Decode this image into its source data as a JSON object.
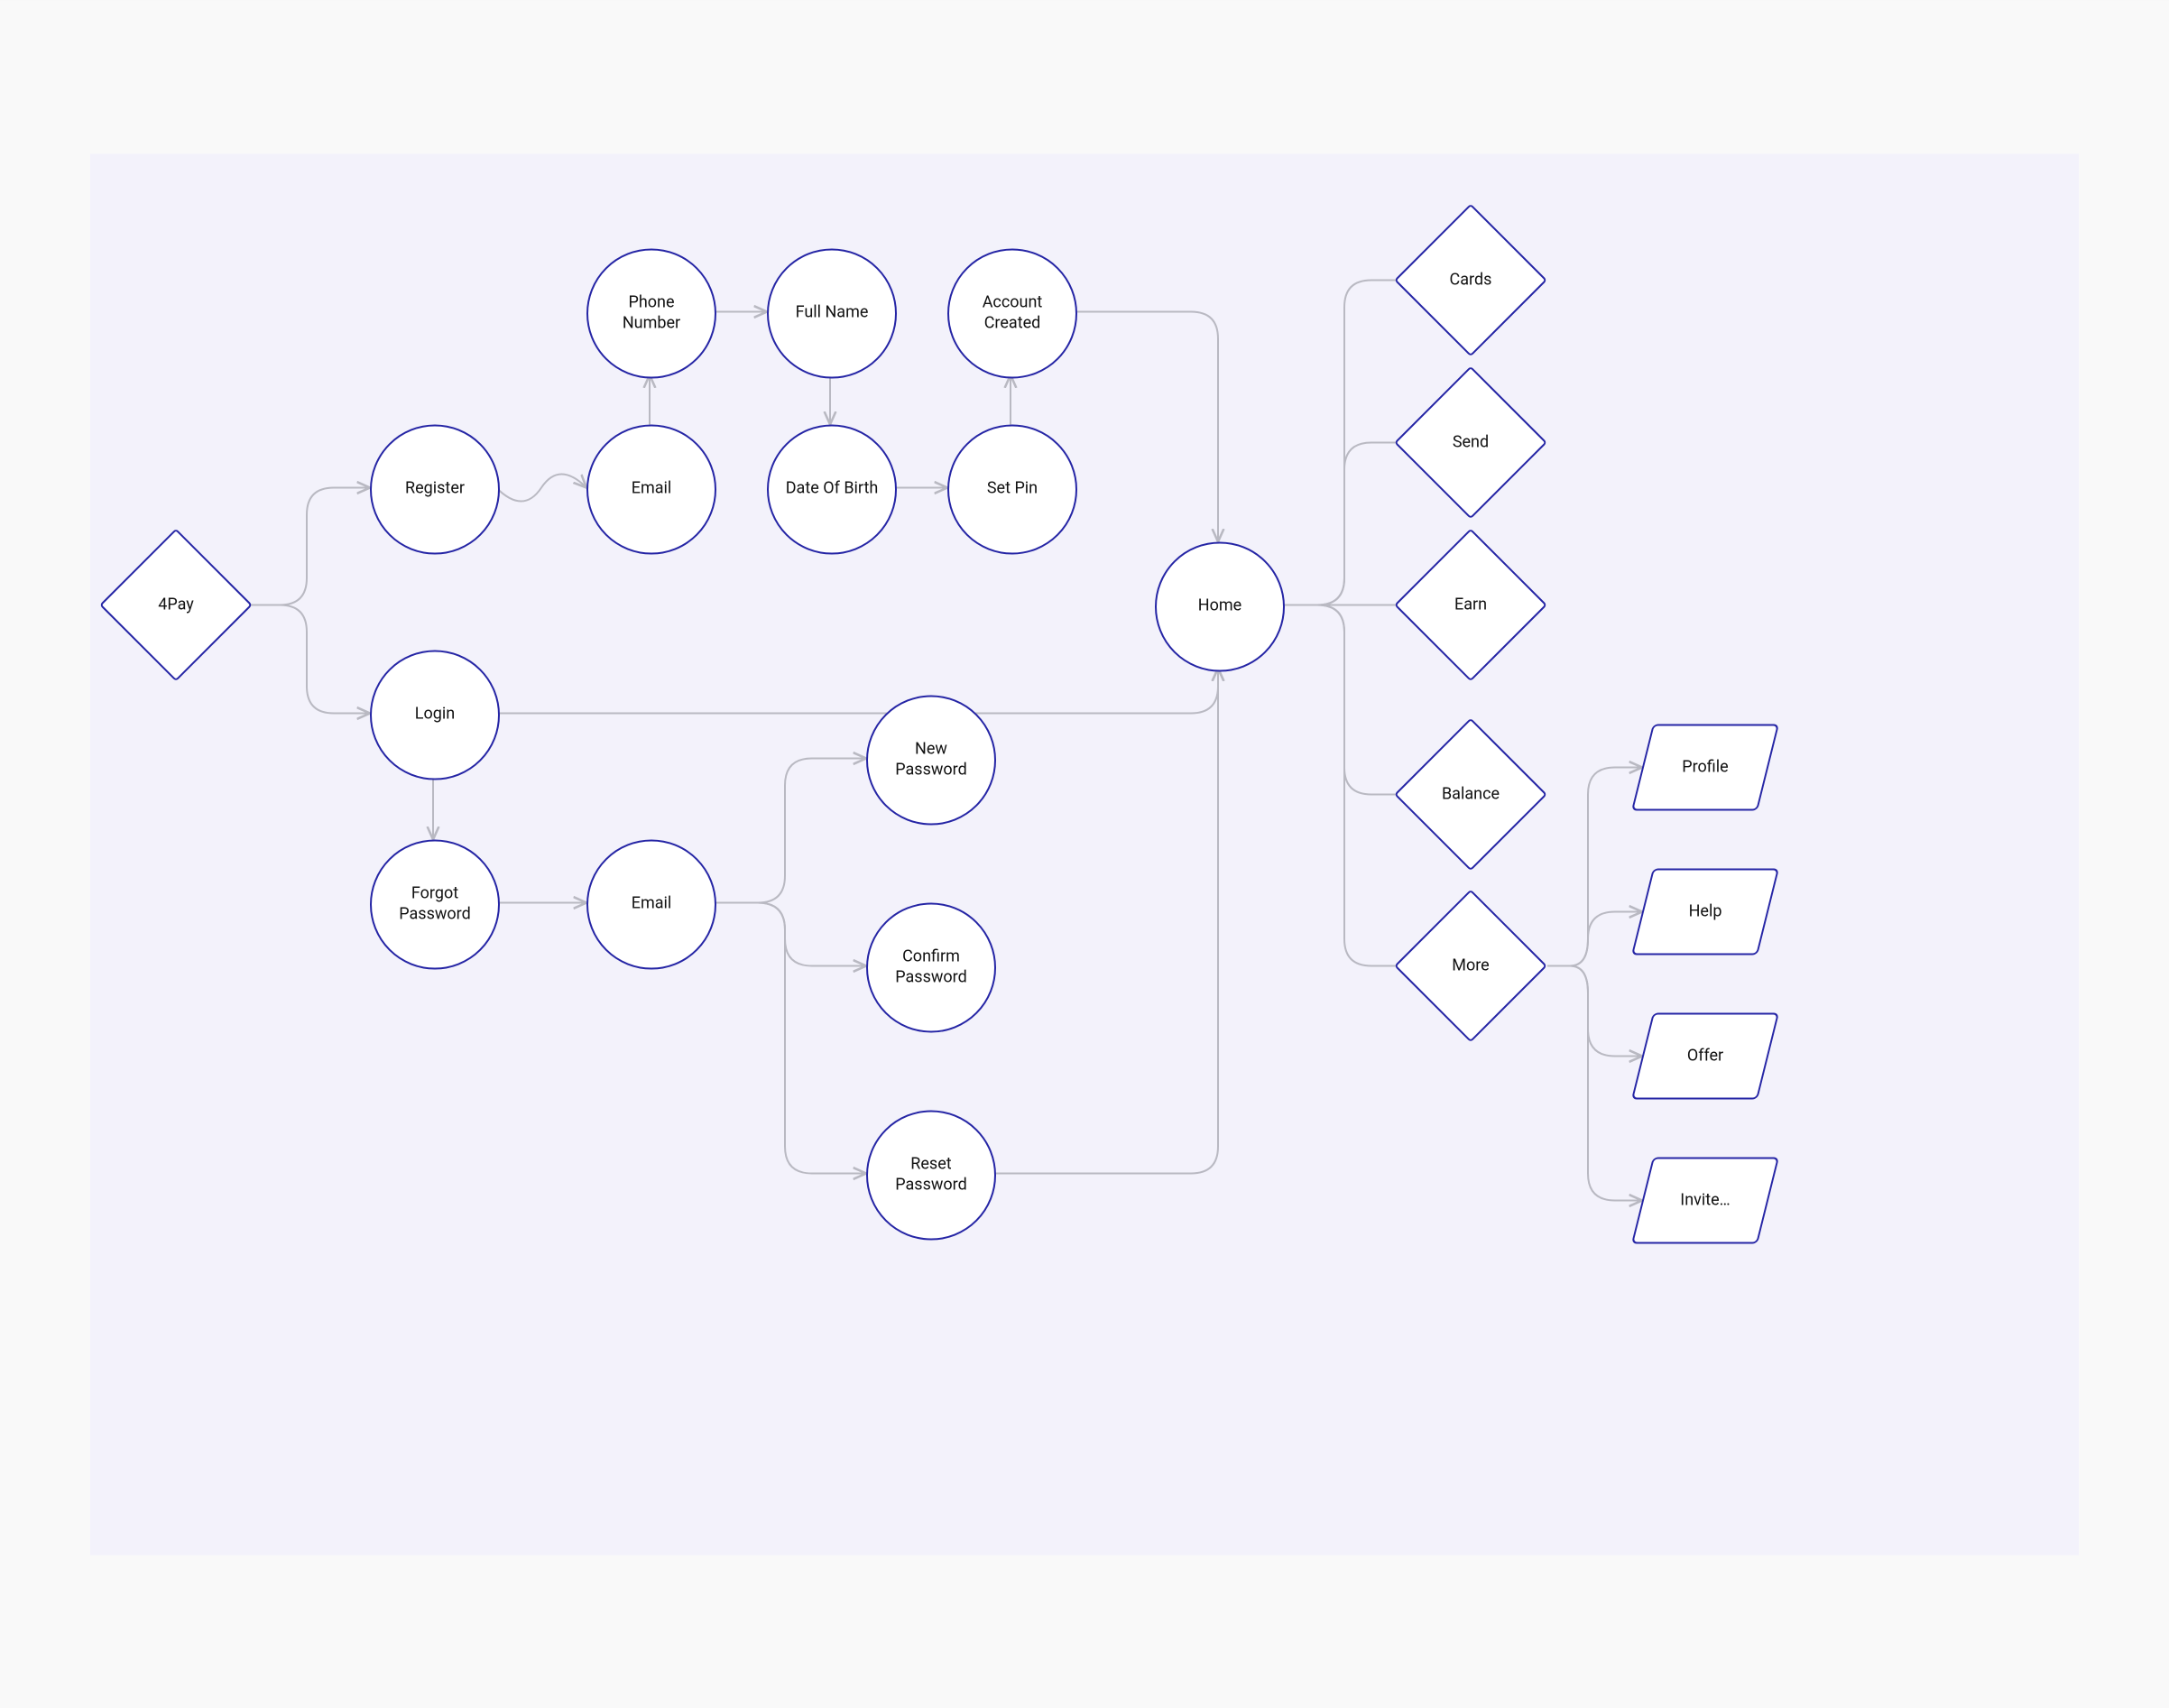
{
  "nodes": {
    "start": "4Pay",
    "register": "Register",
    "login": "Login",
    "forgot": "Forgot\nPassword",
    "email1": "Email",
    "phone": "Phone\nNumber",
    "fullname": "Full Name",
    "dob": "Date Of Birth",
    "setpin": "Set Pin",
    "created": "Account\nCreated",
    "email2": "Email",
    "newpw": "New\nPassword",
    "confpw": "Confirm\nPassword",
    "resetpw": "Reset\nPassword",
    "home": "Home",
    "cards": "Cards",
    "send": "Send",
    "earn": "Earn",
    "balance": "Balance",
    "more": "More",
    "profile": "Profile",
    "help": "Help",
    "offer": "Offer",
    "invite": "Invite…"
  },
  "colors": {
    "stroke": "#2525a5",
    "edge": "#b9b9c2",
    "bg": "#f3f2fb"
  }
}
